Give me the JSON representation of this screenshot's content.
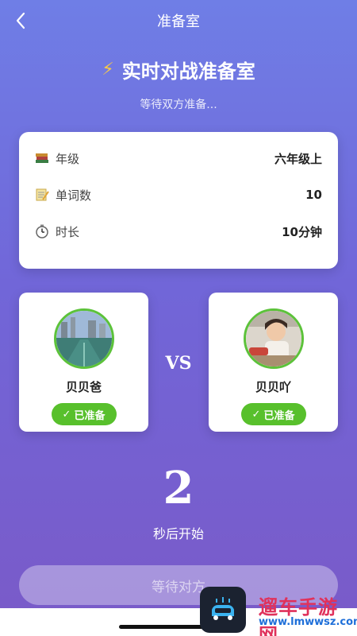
{
  "nav": {
    "title": "准备室"
  },
  "hero": {
    "title": "实时对战准备室",
    "subtitle": "等待双方准备..."
  },
  "info": [
    {
      "icon": "books-icon",
      "label": "年级",
      "value": "六年级上"
    },
    {
      "icon": "memo-icon",
      "label": "单词数",
      "value": "10"
    },
    {
      "icon": "stopwatch-icon",
      "label": "时长",
      "value": "10分钟"
    }
  ],
  "players": [
    {
      "name": "贝贝爸",
      "status": "已准备"
    },
    {
      "name": "贝贝吖",
      "status": "已准备"
    }
  ],
  "vs": "VS",
  "countdown": {
    "value": "2",
    "label": "秒后开始"
  },
  "action": {
    "label": "等待对方"
  },
  "watermark": {
    "text": "遛车手游网",
    "url": "www.lmwwsz.com"
  },
  "colors": {
    "ready": "#58c02c",
    "avatar_border": "#5cc23a",
    "watermark_red": "#e0315b",
    "watermark_blue": "#1e6fd9"
  }
}
